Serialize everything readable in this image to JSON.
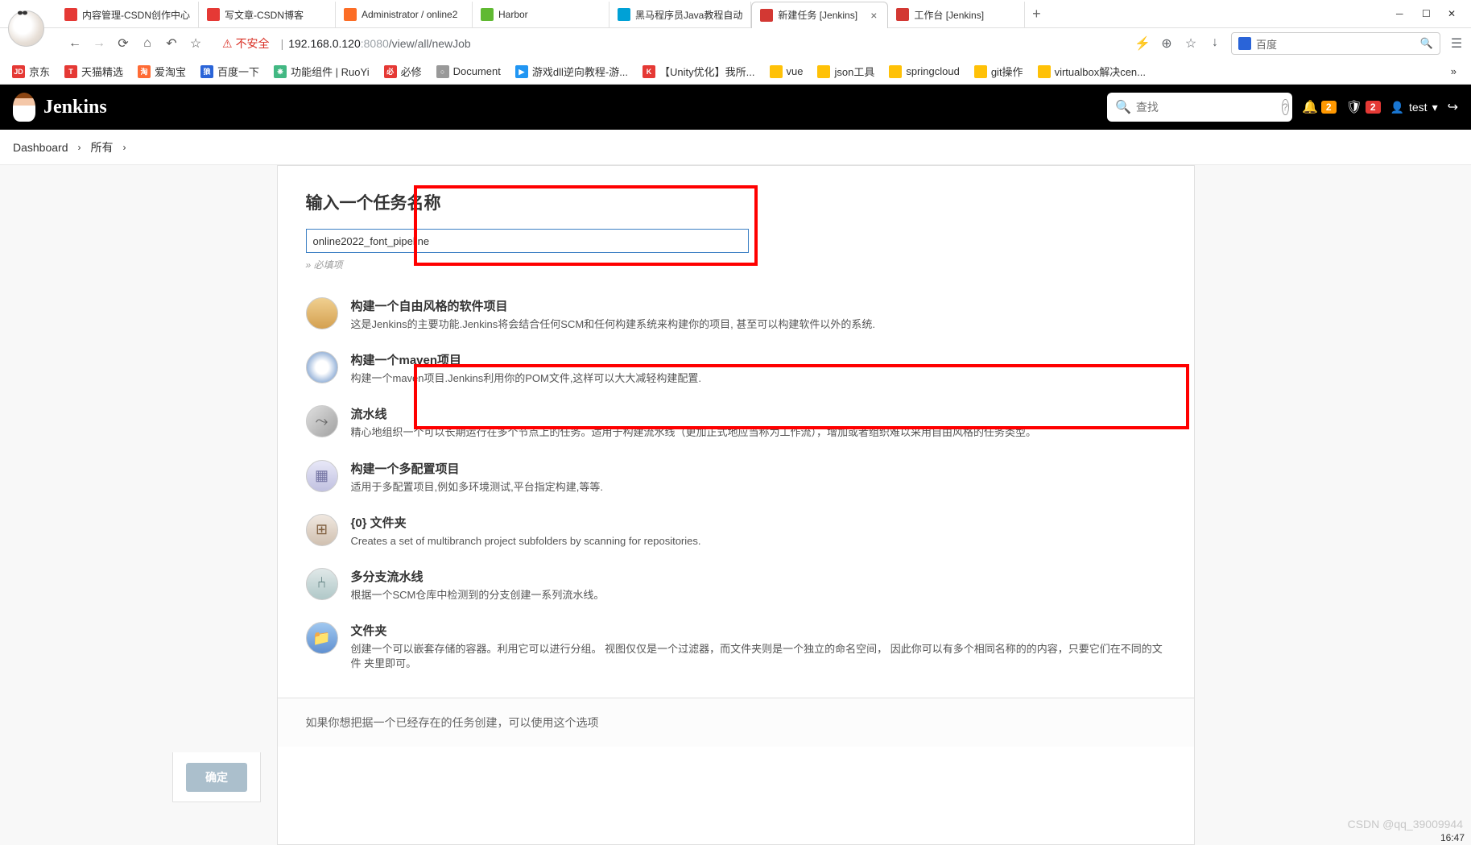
{
  "browser": {
    "tabs": [
      {
        "label": "内容管理-CSDN创作中心",
        "icon": "csdn"
      },
      {
        "label": "写文章-CSDN博客",
        "icon": "csdn"
      },
      {
        "label": "Administrator / online2",
        "icon": "gitlab"
      },
      {
        "label": "Harbor",
        "icon": "harbor"
      },
      {
        "label": "黑马程序员Java教程自动",
        "icon": "bilibili"
      },
      {
        "label": "新建任务 [Jenkins]",
        "icon": "jenkins",
        "active": true
      },
      {
        "label": "工作台 [Jenkins]",
        "icon": "jenkins"
      }
    ],
    "insecure_label": "不安全",
    "url_host": "192.168.0.120",
    "url_port": ":8080",
    "url_path": "/view/all/newJob",
    "baidu_label": "百度",
    "bookmarks": [
      {
        "label": "京东",
        "color": "#e53935",
        "text": "JD"
      },
      {
        "label": "天猫精选",
        "color": "#e53935",
        "text": "T"
      },
      {
        "label": "爱淘宝",
        "color": "#ff6b35",
        "text": "淘"
      },
      {
        "label": "百度一下",
        "color": "#2a64d8",
        "text": "狼"
      },
      {
        "label": "功能组件 | RuoYi",
        "color": "#42b883",
        "text": "❋"
      },
      {
        "label": "必修",
        "color": "#e53935",
        "text": "必"
      },
      {
        "label": "Document",
        "color": "#999",
        "text": "○"
      },
      {
        "label": "游戏dll逆向教程-游...",
        "color": "#2196f3",
        "text": "▶"
      },
      {
        "label": "【Unity优化】我所...",
        "color": "#e53935",
        "text": "K"
      },
      {
        "label": "vue",
        "color": "#ffc107",
        "folder": true
      },
      {
        "label": "json工具",
        "color": "#ffc107",
        "folder": true
      },
      {
        "label": "springcloud",
        "color": "#ffc107",
        "folder": true
      },
      {
        "label": "git操作",
        "color": "#ffc107",
        "folder": true
      },
      {
        "label": "virtualbox解决cen...",
        "color": "#ffc107",
        "folder": true
      }
    ]
  },
  "jenkins": {
    "title": "Jenkins",
    "search_placeholder": "查找",
    "notif_count": "2",
    "warn_count": "2",
    "user": "test",
    "breadcrumbs": [
      {
        "label": "Dashboard"
      },
      {
        "label": "所有"
      }
    ]
  },
  "form": {
    "title": "输入一个任务名称",
    "name_value": "online2022_font_pipeline",
    "required": "» 必填项",
    "ok_button": "确定",
    "copy_hint": "如果你想把据一个已经存在的任务创建，可以使用这个选项"
  },
  "job_types": [
    {
      "id": "freestyle",
      "title": "构建一个自由风格的软件项目",
      "desc": "这是Jenkins的主要功能.Jenkins将会结合任何SCM和任何构建系统来构建你的项目, 甚至可以构建软件以外的系统."
    },
    {
      "id": "maven",
      "title": "构建一个maven项目",
      "desc": "构建一个maven项目.Jenkins利用你的POM文件,这样可以大大减轻构建配置."
    },
    {
      "id": "pipeline",
      "title": "流水线",
      "desc": "精心地组织一个可以长期运行在多个节点上的任务。适用于构建流水线（更加正式地应当称为工作流），增加或者组织难以采用自由风格的任务类型。"
    },
    {
      "id": "multiconfig",
      "title": "构建一个多配置项目",
      "desc": "适用于多配置项目,例如多环境测试,平台指定构建,等等."
    },
    {
      "id": "org",
      "title": "{0} 文件夹",
      "desc": "Creates a set of multibranch project subfolders by scanning for repositories."
    },
    {
      "id": "multibranch",
      "title": "多分支流水线",
      "desc": "根据一个SCM仓库中检测到的分支创建一系列流水线。"
    },
    {
      "id": "folder",
      "title": "文件夹",
      "desc": "创建一个可以嵌套存储的容器。利用它可以进行分组。 视图仅仅是一个过滤器，而文件夹则是一个独立的命名空间， 因此你可以有多个相同名称的的内容，只要它们在不同的文件 夹里即可。"
    }
  ],
  "watermark": "CSDN @qq_39009944",
  "time": "16:47"
}
